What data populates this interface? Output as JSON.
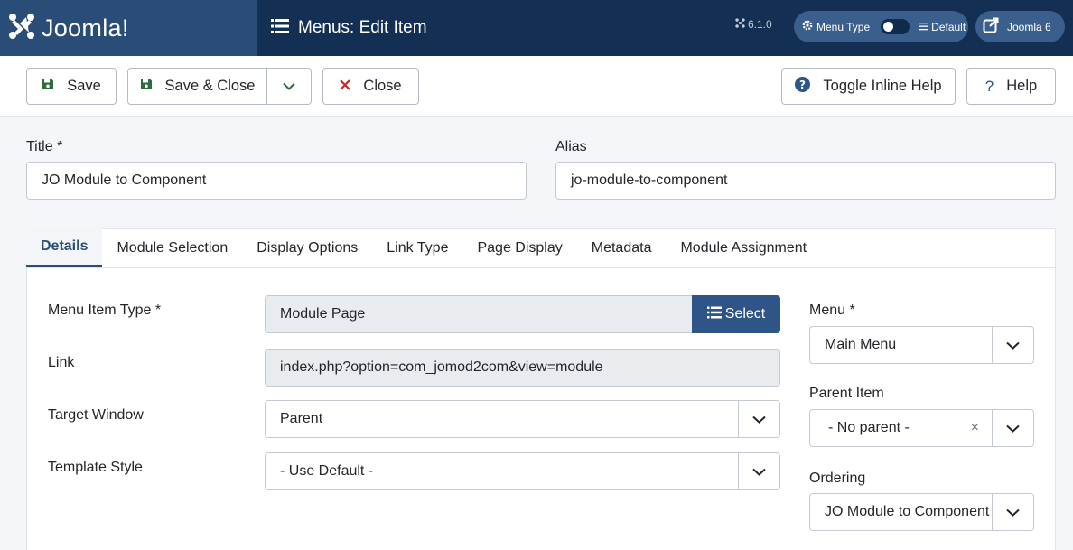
{
  "header": {
    "logo_text": "Joomla!",
    "page_title": "Menus: Edit Item",
    "version": "6.1.0",
    "menu_type_label": "Menu Type",
    "menu_type_value": "Default",
    "site_label": "Joomla 6"
  },
  "toolbar": {
    "save": "Save",
    "save_close": "Save & Close",
    "close": "Close",
    "toggle_help": "Toggle Inline Help",
    "help": "Help"
  },
  "form": {
    "title_label": "Title *",
    "title_value": "JO Module to Component",
    "alias_label": "Alias",
    "alias_value": "jo-module-to-component"
  },
  "tabs": [
    "Details",
    "Module Selection",
    "Display Options",
    "Link Type",
    "Page Display",
    "Metadata",
    "Module Assignment"
  ],
  "details": {
    "menu_item_type_label": "Menu Item Type *",
    "menu_item_type_value": "Module Page",
    "select_label": "Select",
    "link_label": "Link",
    "link_value": "index.php?option=com_jomod2com&view=module",
    "target_window_label": "Target Window",
    "target_window_value": "Parent",
    "template_style_label": "Template Style",
    "template_style_value": "- Use Default -"
  },
  "sidebar": {
    "menu_label": "Menu *",
    "menu_value": "Main Menu",
    "parent_label": "Parent Item",
    "parent_value": "- No parent -",
    "ordering_label": "Ordering",
    "ordering_value": "JO Module to Component"
  },
  "colors": {
    "header_bg": "#132f53",
    "accent": "#2a4d78",
    "save_icon": "#2e6b3e",
    "close_icon": "#c52827"
  }
}
